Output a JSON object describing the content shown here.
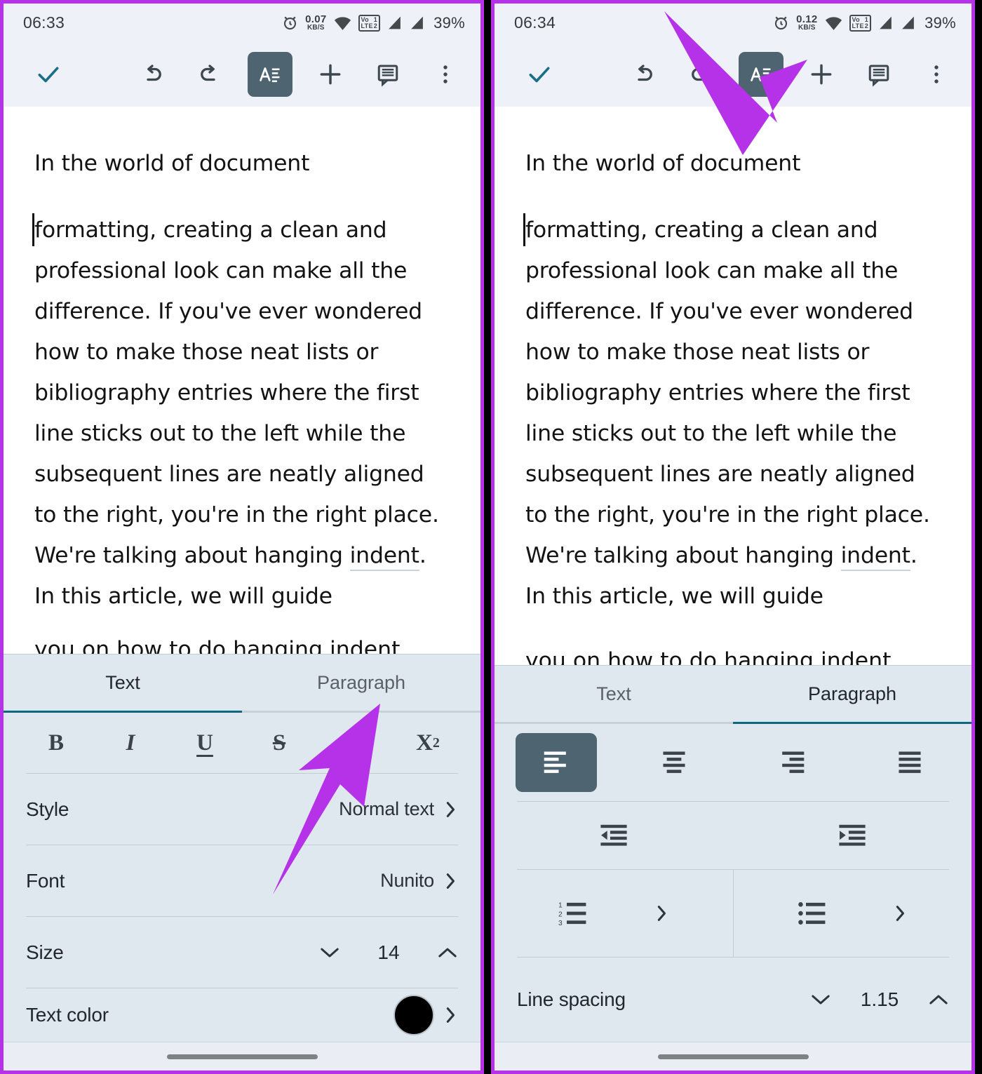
{
  "meta": {
    "accent_teal": "#10677f",
    "panel_bg": "#dfe8ef",
    "bar_bg": "#eef1f7",
    "arrow_purple": "#b532e8",
    "selected_btn": "#4f6471"
  },
  "document": {
    "paragraph_1": "In the world of document",
    "paragraph_2_pre": "formatting, creating a clean and professional look can make all the difference. If you've ever wondered how to make those neat lists or bibliography entries where the first line sticks out to the left while the subsequent lines are neatly aligned to the right, you're in the right place. We're talking about hanging ",
    "paragraph_2_underlined": "indent",
    "paragraph_2_post": ". In this article, we will guide",
    "paragraph_2_clipped": "you on how to do hanging indent"
  },
  "left_phone": {
    "status": {
      "clock": "06:33",
      "alarm_icon": "alarm-clock-icon",
      "data_rate_value": "0.07",
      "data_rate_unit": "KB/S",
      "wifi_icon": "wifi-icon",
      "volte_label_top": "Vo",
      "volte_label_bottom": "LTE",
      "sim1": "1",
      "sim2": "2",
      "signal_icon": "signal-bars-icon",
      "battery": "39%"
    },
    "toolbar": {
      "done_icon": "checkmark-icon",
      "undo_icon": "undo-icon",
      "redo_icon": "redo-icon",
      "format_icon": "text-format-icon",
      "add_icon": "plus-icon",
      "comment_icon": "comment-icon",
      "more_icon": "more-vertical-icon"
    },
    "tabs": [
      {
        "label": "Text",
        "active": true
      },
      {
        "label": "Paragraph",
        "active": false
      }
    ],
    "text_format_buttons": [
      {
        "name": "bold-button",
        "glyph": "B"
      },
      {
        "name": "italic-button",
        "glyph": "I"
      },
      {
        "name": "underline-button",
        "glyph": "U"
      },
      {
        "name": "strikethrough-button",
        "glyph": "S"
      },
      {
        "name": "superscript-button",
        "glyph": "X",
        "script": "2"
      },
      {
        "name": "subscript-button",
        "glyph": "X",
        "script": "2"
      }
    ],
    "rows": {
      "style_label": "Style",
      "style_value": "Normal text",
      "font_label": "Font",
      "font_value": "Nunito",
      "size_label": "Size",
      "size_value": "14",
      "text_color_label": "Text color",
      "text_color_value": "#000000"
    }
  },
  "right_phone": {
    "status": {
      "clock": "06:34",
      "alarm_icon": "alarm-clock-icon",
      "data_rate_value": "0.12",
      "data_rate_unit": "KB/S",
      "wifi_icon": "wifi-icon",
      "volte_label_top": "Vo",
      "volte_label_bottom": "LTE",
      "sim1": "1",
      "sim2": "2",
      "signal_icon": "signal-bars-icon",
      "battery": "39%"
    },
    "toolbar": {
      "done_icon": "checkmark-icon",
      "undo_icon": "undo-icon",
      "redo_icon": "redo-icon",
      "format_icon": "text-format-icon",
      "add_icon": "plus-icon",
      "comment_icon": "comment-icon",
      "more_icon": "more-vertical-icon"
    },
    "tabs": [
      {
        "label": "Text",
        "active": false
      },
      {
        "label": "Paragraph",
        "active": true
      }
    ],
    "alignment_buttons": [
      {
        "name": "align-left-button",
        "selected": true
      },
      {
        "name": "align-center-button",
        "selected": false
      },
      {
        "name": "align-right-button",
        "selected": false
      },
      {
        "name": "align-justify-button",
        "selected": false
      }
    ],
    "indent_buttons": [
      {
        "name": "decrease-indent-button"
      },
      {
        "name": "increase-indent-button"
      }
    ],
    "list_buttons": [
      {
        "name": "numbered-list-button"
      },
      {
        "name": "bulleted-list-button"
      }
    ],
    "rows": {
      "line_spacing_label": "Line spacing",
      "line_spacing_value": "1.15"
    }
  }
}
